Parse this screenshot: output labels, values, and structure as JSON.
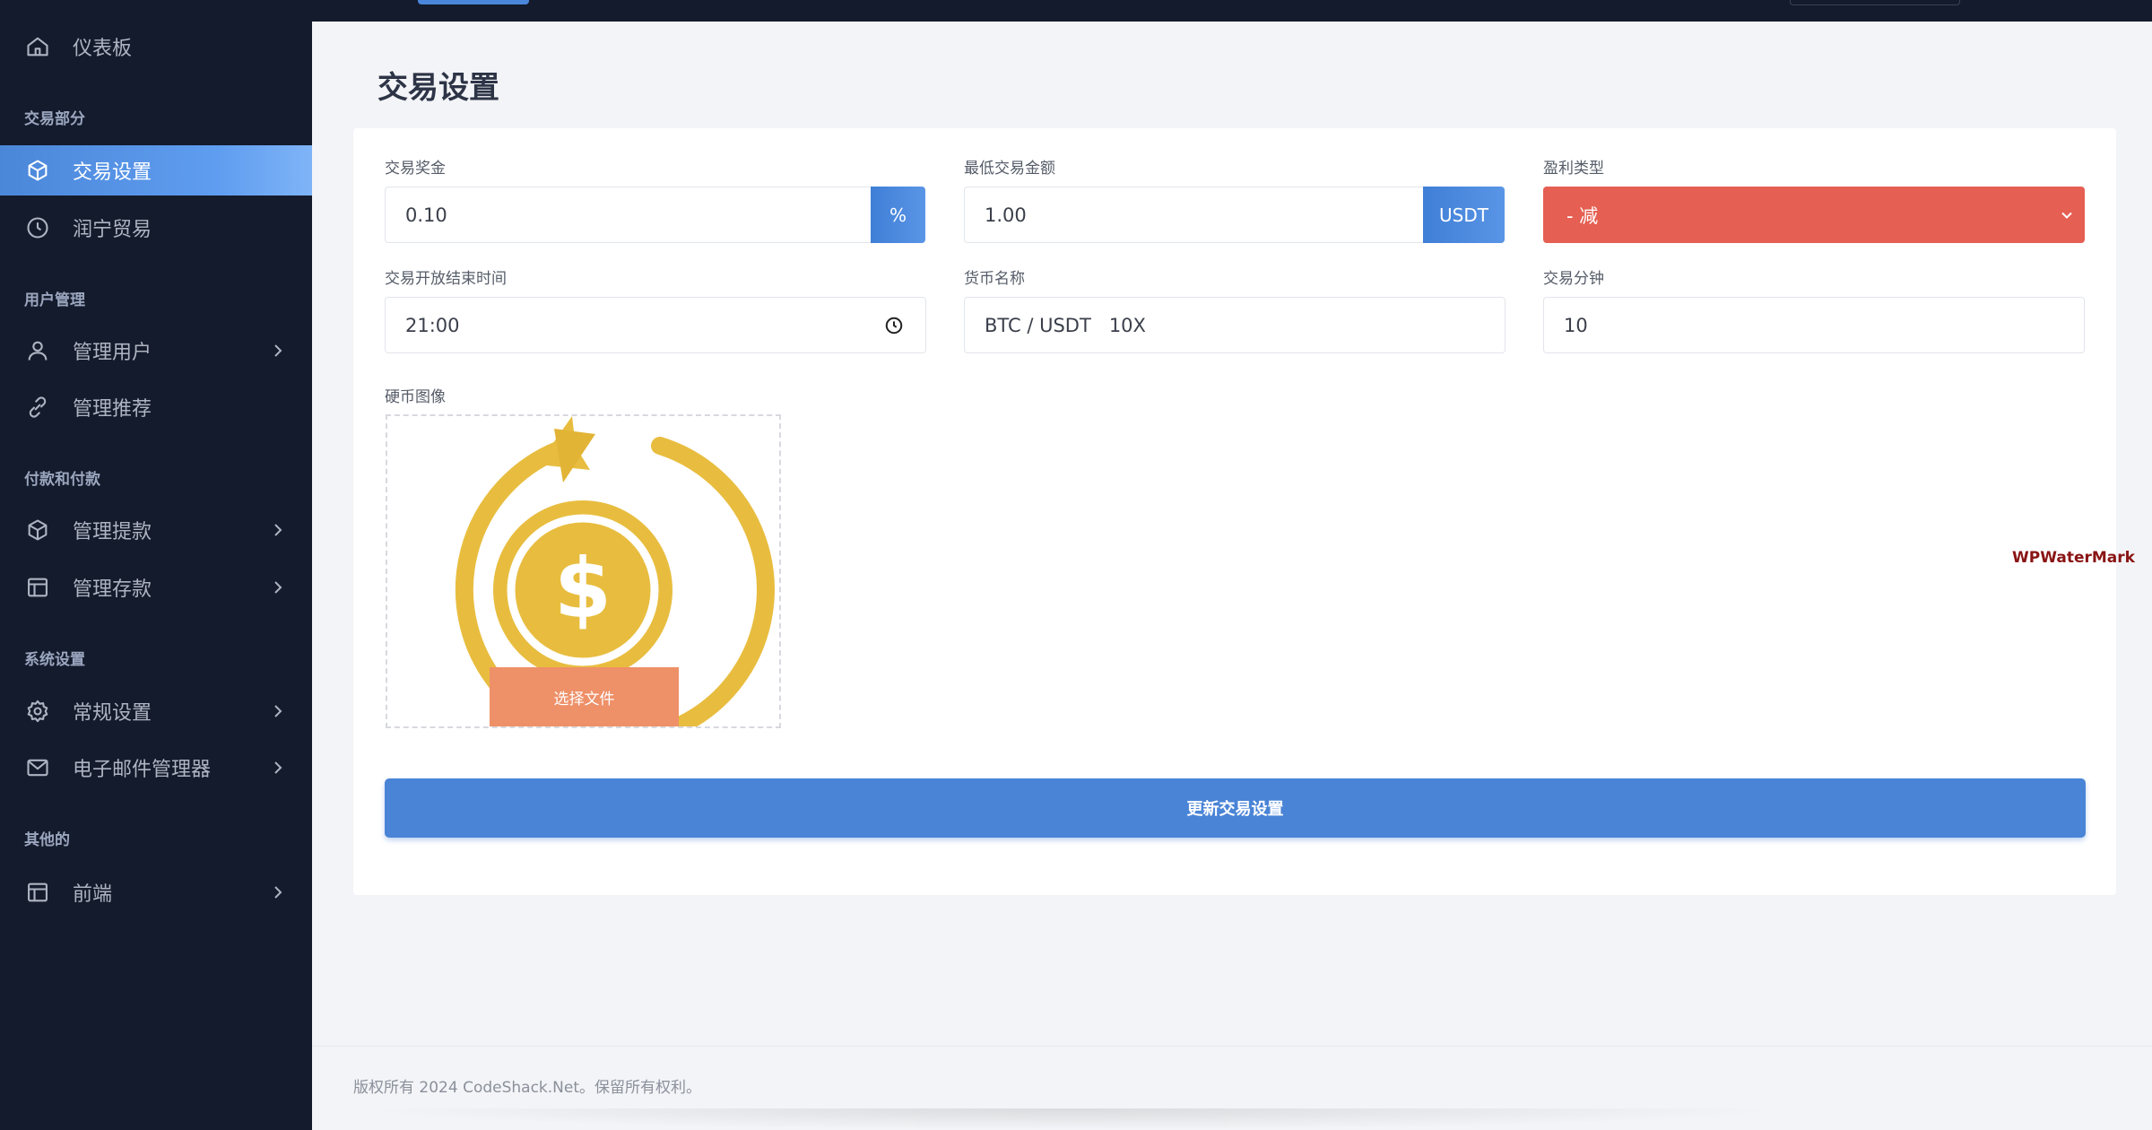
{
  "sidebar": {
    "dashboard": "仪表板",
    "section_trade": "交易部分",
    "trade_settings": "交易设置",
    "runing_trade": "润宁贸易",
    "section_users": "用户管理",
    "manage_users": "管理用户",
    "manage_referrals": "管理推荐",
    "section_payments": "付款和付款",
    "manage_withdrawals": "管理提款",
    "manage_deposits": "管理存款",
    "section_system": "系统设置",
    "general_settings": "常规设置",
    "email_manager": "电子邮件管理器",
    "section_other": "其他的",
    "frontend": "前端"
  },
  "page": {
    "title": "交易设置"
  },
  "form": {
    "trade_bonus_label": "交易奖金",
    "trade_bonus_value": "0.10",
    "trade_bonus_unit": "%",
    "min_amount_label": "最低交易金额",
    "min_amount_value": "1.00",
    "min_amount_unit": "USDT",
    "profit_type_label": "盈利类型",
    "profit_type_value": "- 减",
    "open_close_time_label": "交易开放结束时间",
    "open_close_time_value": "21:00",
    "currency_name_label": "货币名称",
    "currency_name_value": "BTC / USDT   10X",
    "trade_minutes_label": "交易分钟",
    "trade_minutes_value": "10",
    "coin_image_label": "硬币图像",
    "choose_file": "选择文件",
    "submit": "更新交易设置"
  },
  "watermark": "WPWaterMark",
  "footer": {
    "copyright": "版权所有 2024 CodeShack.Net。保留所有权利。"
  },
  "colors": {
    "sidebar_bg": "#141b2c",
    "accent": "#4a84d7",
    "profit_select": "#e55f52",
    "choose_file": "#ee9068",
    "coin_gold": "#e8bd3f"
  },
  "icons": {
    "dashboard": "home-icon",
    "trade_settings": "cube-icon",
    "runing_trade": "clock-icon",
    "manage_users": "user-icon",
    "manage_referrals": "link-icon",
    "manage_withdrawals": "cube-icon",
    "manage_deposits": "table-icon",
    "general_settings": "gear-icon",
    "email_manager": "mail-icon",
    "frontend": "layout-icon"
  }
}
